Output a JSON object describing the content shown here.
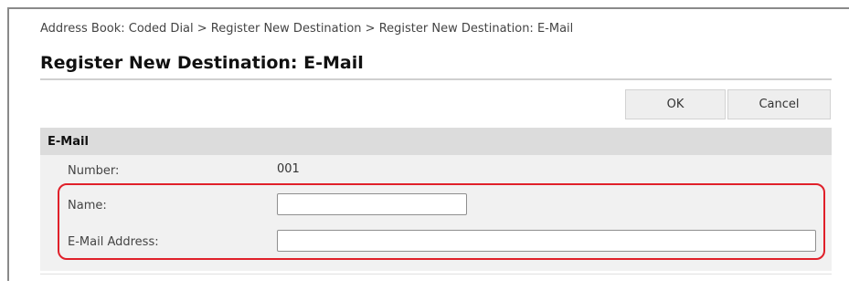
{
  "breadcrumb": {
    "text": "Address Book: Coded Dial > Register New Destination > Register New Destination: E-Mail"
  },
  "page": {
    "title": "Register New Destination: E-Mail"
  },
  "toolbar": {
    "ok_label": "OK",
    "cancel_label": "Cancel"
  },
  "section": {
    "header": "E-Mail"
  },
  "form": {
    "number_label": "Number:",
    "number_value": "001",
    "name_label": "Name:",
    "name_value": "",
    "email_label": "E-Mail Address:",
    "email_value": ""
  },
  "colors": {
    "highlight": "#e0202a",
    "section_header_bg": "#dcdcdc",
    "section_body_bg": "#f1f1f1"
  }
}
